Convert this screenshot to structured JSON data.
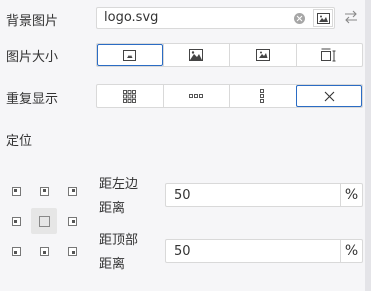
{
  "background": {
    "label": "背景图片",
    "file_value": "logo.svg"
  },
  "size": {
    "label": "图片大小",
    "options": [
      "auto-icon",
      "cover-icon",
      "contain-icon",
      "custom-size-icon"
    ],
    "active_index": 0
  },
  "repeat": {
    "label": "重复显示",
    "options": [
      "repeat-icon",
      "repeat-x-icon",
      "repeat-y-icon",
      "no-repeat-icon"
    ],
    "active_index": 3
  },
  "position": {
    "label": "定位",
    "grid": [
      "top-left",
      "top-center",
      "top-right",
      "middle-left",
      "center",
      "middle-right",
      "bottom-left",
      "bottom-center",
      "bottom-right"
    ],
    "left_offset": {
      "label_line1": "距左边",
      "label_line2": "距离",
      "value": "50",
      "unit": "%"
    },
    "top_offset": {
      "label_line1": "距顶部",
      "label_line2": "距离",
      "value": "50",
      "unit": "%"
    }
  },
  "colors": {
    "accent": "#2b6cc4",
    "border": "#d9d9d9",
    "panel": "#f6f6f8"
  }
}
